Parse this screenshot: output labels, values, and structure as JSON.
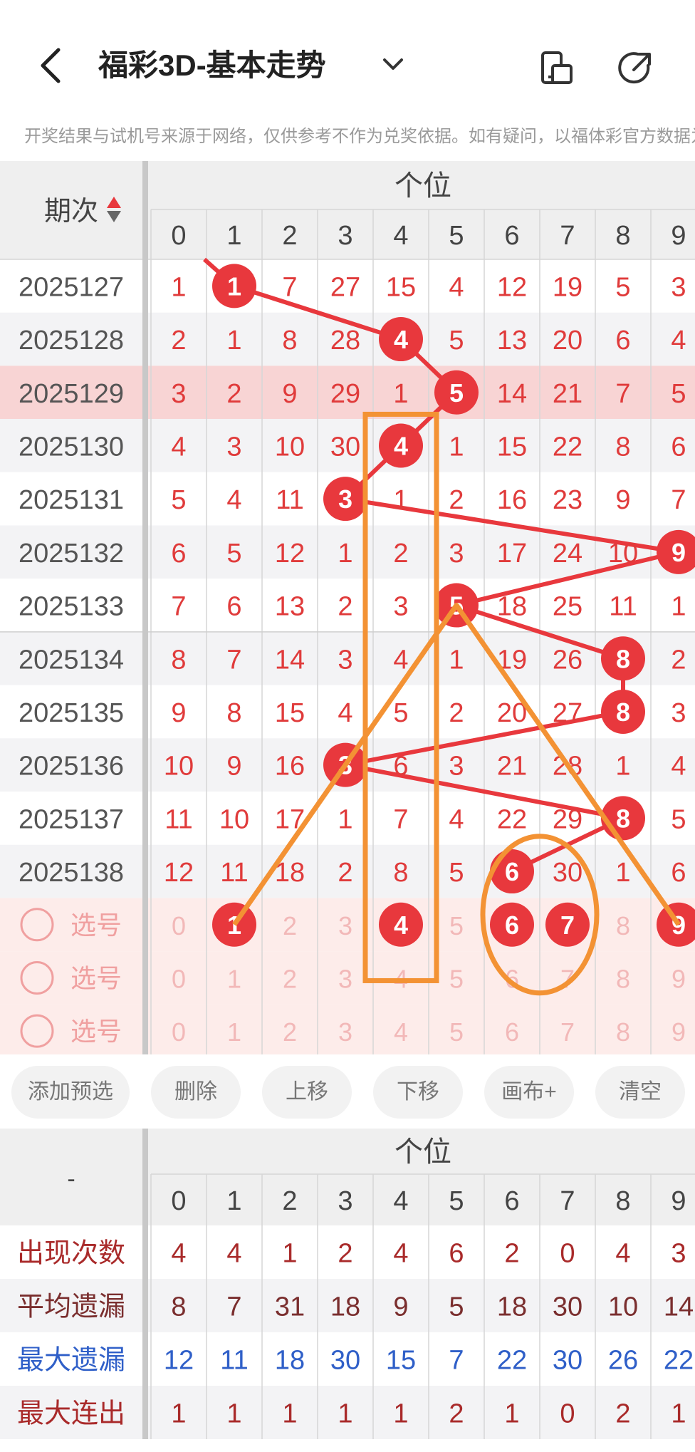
{
  "header": {
    "title": "福彩3D-基本走势",
    "back_icon": "back-arrow-icon",
    "dropdown_icon": "chevron-down-icon",
    "icon_layout": "layout-switch-icon",
    "icon_share": "share-icon"
  },
  "notice": "开奖结果与试机号来源于网络，仅供参考不作为兑奖依据。如有疑问，以福体彩官方数据为准",
  "trend": {
    "group_label": "个位",
    "period_label": "期次",
    "digits": [
      "0",
      "1",
      "2",
      "3",
      "4",
      "5",
      "6",
      "7",
      "8",
      "9"
    ],
    "rows": [
      {
        "issue": "2025127",
        "hit": 1,
        "cells": [
          "1",
          "1",
          "7",
          "27",
          "15",
          "4",
          "12",
          "19",
          "5",
          "3"
        ]
      },
      {
        "issue": "2025128",
        "hit": 4,
        "cells": [
          "2",
          "1",
          "8",
          "28",
          "4",
          "5",
          "13",
          "20",
          "6",
          "4"
        ]
      },
      {
        "issue": "2025129",
        "hit": 5,
        "cells": [
          "3",
          "2",
          "9",
          "29",
          "1",
          "5",
          "14",
          "21",
          "7",
          "5"
        ]
      },
      {
        "issue": "2025130",
        "hit": 4,
        "cells": [
          "4",
          "3",
          "10",
          "30",
          "4",
          "1",
          "15",
          "22",
          "8",
          "6"
        ]
      },
      {
        "issue": "2025131",
        "hit": 3,
        "cells": [
          "5",
          "4",
          "11",
          "3",
          "1",
          "2",
          "16",
          "23",
          "9",
          "7"
        ]
      },
      {
        "issue": "2025132",
        "hit": 9,
        "cells": [
          "6",
          "5",
          "12",
          "1",
          "2",
          "3",
          "17",
          "24",
          "10",
          "9"
        ]
      },
      {
        "issue": "2025133",
        "hit": 5,
        "cells": [
          "7",
          "6",
          "13",
          "2",
          "3",
          "5",
          "18",
          "25",
          "11",
          "1"
        ]
      },
      {
        "issue": "2025134",
        "hit": 8,
        "cells": [
          "8",
          "7",
          "14",
          "3",
          "4",
          "1",
          "19",
          "26",
          "8",
          "2"
        ]
      },
      {
        "issue": "2025135",
        "hit": 8,
        "cells": [
          "9",
          "8",
          "15",
          "4",
          "5",
          "2",
          "20",
          "27",
          "8",
          "3"
        ]
      },
      {
        "issue": "2025136",
        "hit": 3,
        "cells": [
          "10",
          "9",
          "16",
          "3",
          "6",
          "3",
          "21",
          "28",
          "1",
          "4"
        ]
      },
      {
        "issue": "2025137",
        "hit": 8,
        "cells": [
          "11",
          "10",
          "17",
          "1",
          "7",
          "4",
          "22",
          "29",
          "8",
          "5"
        ]
      },
      {
        "issue": "2025138",
        "hit": 6,
        "cells": [
          "12",
          "11",
          "18",
          "2",
          "8",
          "5",
          "6",
          "30",
          "1",
          "6"
        ]
      }
    ],
    "pick_label": "选号",
    "picks": [
      {
        "cells": [
          "0",
          "1",
          "2",
          "3",
          "4",
          "5",
          "6",
          "7",
          "8",
          "9"
        ],
        "selected": [
          1,
          4,
          6,
          7,
          9
        ]
      },
      {
        "cells": [
          "0",
          "1",
          "2",
          "3",
          "4",
          "5",
          "6",
          "7",
          "8",
          "9"
        ],
        "selected": []
      },
      {
        "cells": [
          "0",
          "1",
          "2",
          "3",
          "4",
          "5",
          "6",
          "7",
          "8",
          "9"
        ],
        "selected": []
      }
    ]
  },
  "buttons": [
    "添加预选",
    "删除",
    "上移",
    "下移",
    "画布+",
    "清空"
  ],
  "stats": {
    "corner": "-",
    "group_label": "个位",
    "rows": [
      {
        "label": "出现次数",
        "color": "#a92a2a",
        "values": [
          "4",
          "4",
          "1",
          "2",
          "4",
          "6",
          "2",
          "0",
          "4",
          "3"
        ]
      },
      {
        "label": "平均遗漏",
        "color": "#7a2e2e",
        "values": [
          "8",
          "7",
          "31",
          "18",
          "9",
          "5",
          "18",
          "30",
          "10",
          "14"
        ]
      },
      {
        "label": "最大遗漏",
        "color": "#2f5fc8",
        "values": [
          "12",
          "11",
          "18",
          "30",
          "15",
          "7",
          "22",
          "30",
          "26",
          "22"
        ]
      },
      {
        "label": "最大连出",
        "color": "#a92a2a",
        "values": [
          "1",
          "1",
          "1",
          "1",
          "1",
          "2",
          "1",
          "0",
          "2",
          "1"
        ]
      }
    ]
  },
  "colors": {
    "hit_ball": "#e8383d",
    "trend_line": "#e8383d",
    "overlay": "#f39234",
    "missing_text": "#e03b3b",
    "pick_bg": "#fdecea",
    "highlight_row": "#f8d4d4"
  }
}
